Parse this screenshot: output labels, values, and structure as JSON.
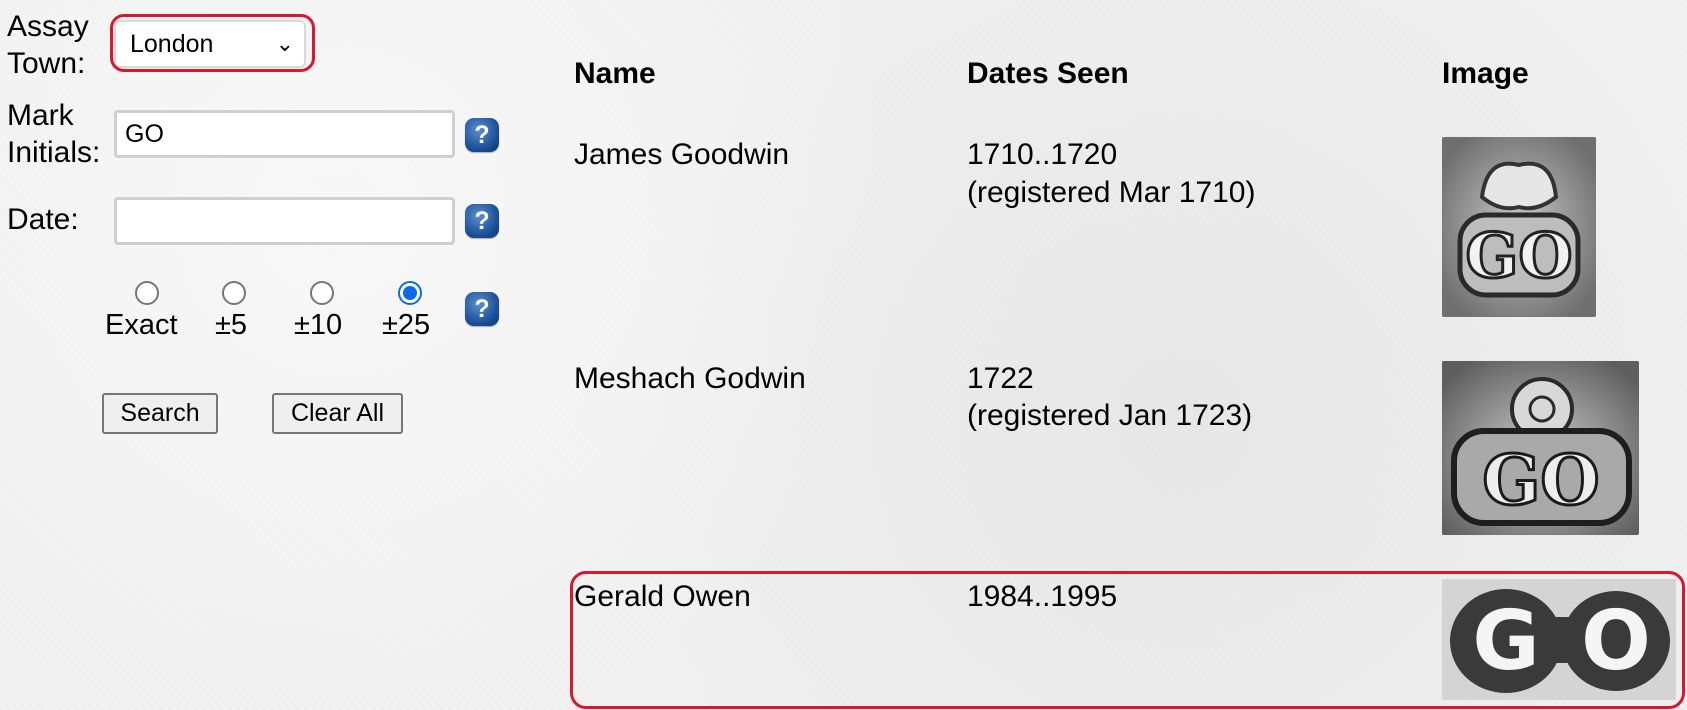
{
  "form": {
    "assay_town_label": "Assay Town:",
    "assay_town_value": "London",
    "mark_initials_label": "Mark Initials:",
    "mark_initials_value": "GO",
    "date_label": "Date:",
    "date_value": "",
    "help_glyph": "?",
    "radio_options": [
      {
        "label": "Exact",
        "checked": false
      },
      {
        "label": "±5",
        "checked": false
      },
      {
        "label": "±10",
        "checked": false
      },
      {
        "label": "±25",
        "checked": true
      }
    ],
    "search_button": "Search",
    "clear_button": "Clear All"
  },
  "table": {
    "headers": {
      "name": "Name",
      "dates": "Dates Seen",
      "image": "Image"
    },
    "rows": [
      {
        "name": "James Goodwin",
        "dates": "1710..1720",
        "registered": "(registered Mar 1710)",
        "mark_initials": "GO"
      },
      {
        "name": "Meshach Godwin",
        "dates": "1722",
        "registered": "(registered Jan 1723)",
        "mark_initials": "GO"
      },
      {
        "name": "Gerald Owen",
        "dates": "1984..1995",
        "registered": "",
        "mark_initials": "GO"
      }
    ]
  },
  "colors": {
    "highlight": "#d7192f",
    "radio_selected": "#0a6be8",
    "help_icon": "#1b4e97"
  }
}
